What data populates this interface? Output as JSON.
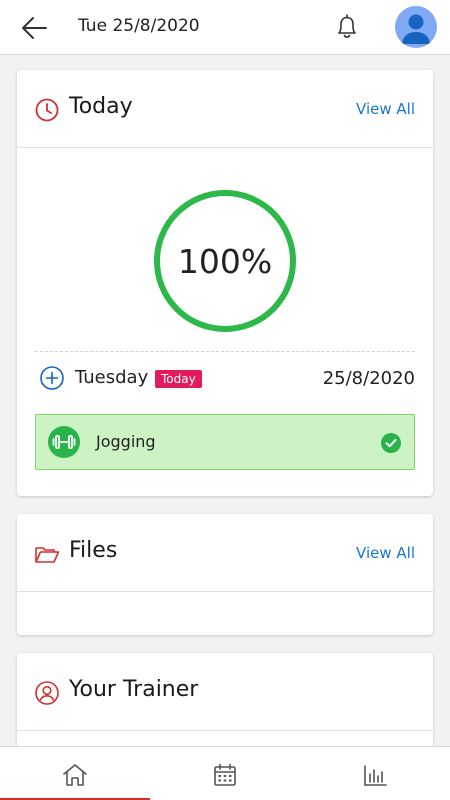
{
  "header": {
    "date": "Tue 25/8/2020"
  },
  "today": {
    "title": "Today",
    "view_all": "View All",
    "progress_text": "100%",
    "progress_fraction": 1.0,
    "day_name": "Tuesday",
    "badge": "Today",
    "day_date": "25/8/2020",
    "activity": {
      "label": "Jogging",
      "completed": true
    }
  },
  "files": {
    "title": "Files",
    "view_all": "View All"
  },
  "trainer": {
    "title": "Your Trainer"
  },
  "tabs": [
    {
      "icon": "home-icon",
      "active": true
    },
    {
      "icon": "calendar-icon",
      "active": false
    },
    {
      "icon": "stats-icon",
      "active": false
    }
  ],
  "colors": {
    "accent_red": "#d32f2f",
    "link_blue": "#1976d2",
    "progress_green": "#2db84a",
    "badge_pink": "#e31b5d",
    "activity_bg": "#cdf2c4"
  }
}
